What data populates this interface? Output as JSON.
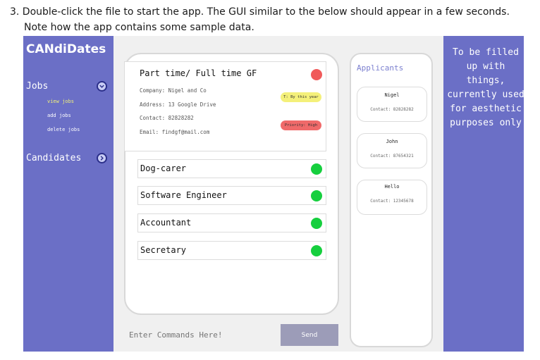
{
  "instructions": {
    "line1": "3. Double-click the file to start the app. The GUI similar to the below should appear in a few seconds.",
    "line2": "Note how the app contains some sample data."
  },
  "app": {
    "logo": "CANdiDates",
    "colors": {
      "sidebar": "#6b6fc6",
      "accent_text": "#7b7fcf",
      "active_subitem": "#f2f27a",
      "status_green": "#16cf3e",
      "status_red": "#f05a5a"
    },
    "sidebar": {
      "jobs_label": "Jobs",
      "jobs_icon": "chevron-down-icon",
      "job_items": [
        "view jobs",
        "add jobs",
        "delete jobs"
      ],
      "candidates_label": "Candidates",
      "candidates_icon": "chevron-right-icon"
    },
    "expanded_job": {
      "title": "Part time/ Full time GF",
      "company": "Company: Nigel and Co",
      "address": "Address: 13 Google Drive",
      "contact": "Contact: 82828282",
      "email": "Email: findgf@mail.com",
      "time_badge": "T: By this year",
      "priority_badge": "Priority: High",
      "status": "red"
    },
    "jobs": [
      {
        "label": "Dog-carer",
        "status": "green"
      },
      {
        "label": "Software Engineer",
        "status": "green"
      },
      {
        "label": "Accountant",
        "status": "green"
      },
      {
        "label": "Secretary",
        "status": "green"
      }
    ],
    "command": {
      "placeholder": "Enter Commands Here!",
      "send_label": "Send"
    },
    "applicants": {
      "title": "Applicants",
      "items": [
        {
          "name": "Nigel",
          "contact": "Contact: 82828282"
        },
        {
          "name": "John",
          "contact": "Contact: 87654321"
        },
        {
          "name": "Hello",
          "contact": "Contact: 12345678"
        }
      ]
    },
    "right_panel_text": "To be filled up with things, currently used for aesthetic purposes only"
  }
}
